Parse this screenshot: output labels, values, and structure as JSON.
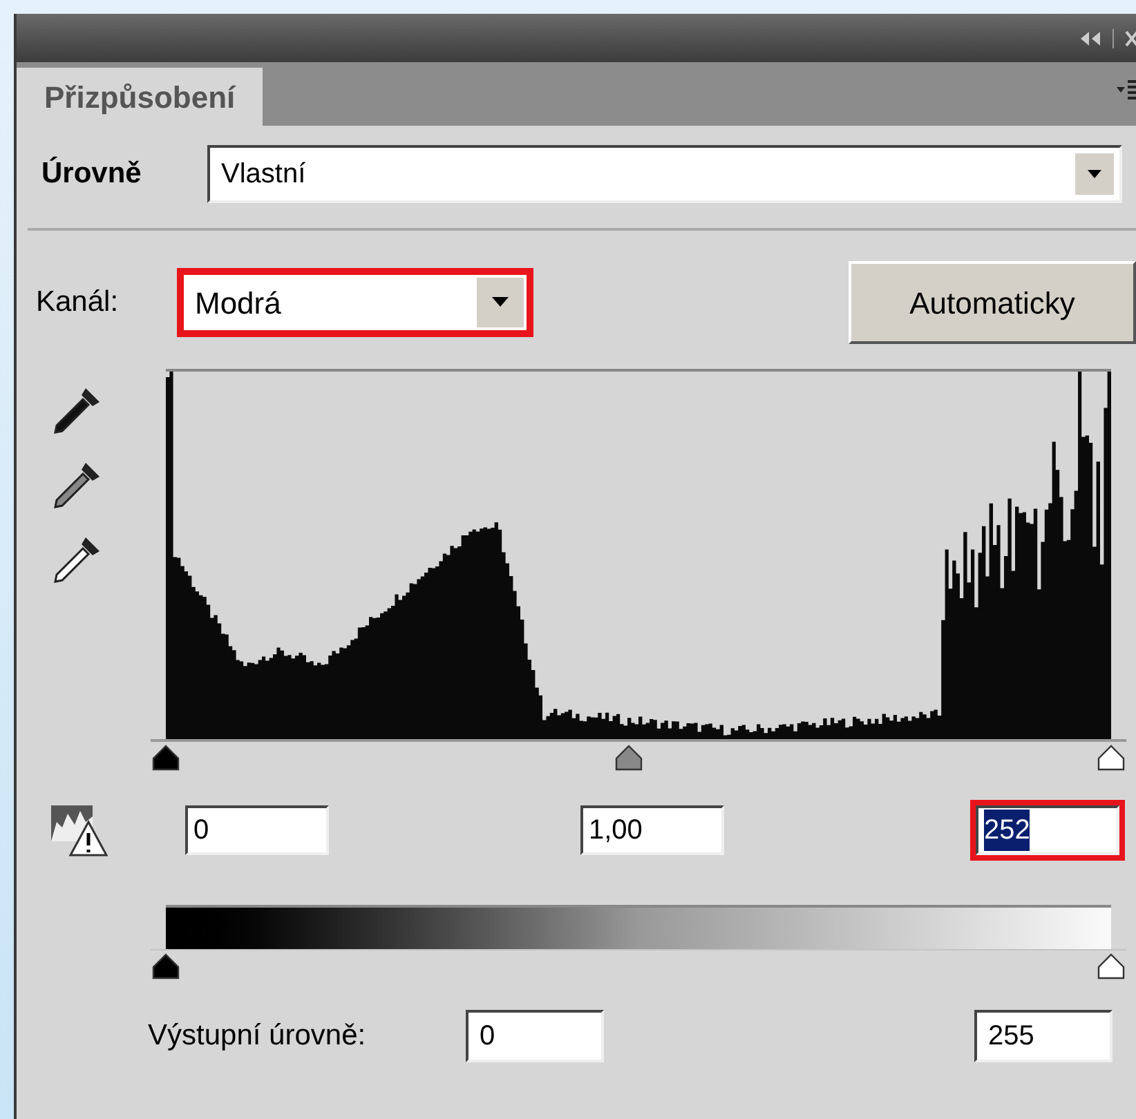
{
  "tab": {
    "label": "Přizpůsobení",
    "selected": true
  },
  "preset": {
    "label": "Úrovně",
    "value": "Vlastní"
  },
  "channel": {
    "label": "Kanál:",
    "value": "Modrá",
    "highlighted": true
  },
  "auto_button": "Automaticky",
  "input_sliders": [
    {
      "kind": "black",
      "level": 0
    },
    {
      "kind": "gray",
      "level": 0.49
    },
    {
      "kind": "white",
      "level": 1
    }
  ],
  "input_fields": [
    {
      "value": "0",
      "highlighted": false,
      "text_selected": false
    },
    {
      "value": "1,00",
      "highlighted": false,
      "text_selected": false
    },
    {
      "value": "252",
      "highlighted": true,
      "text_selected": true
    }
  ],
  "output_label": "Výstupní úrovně:",
  "output_sliders": [
    {
      "kind": "black",
      "level": 0
    },
    {
      "kind": "white",
      "level": 1
    }
  ],
  "output_fields": [
    {
      "value": "0"
    },
    {
      "value": "255"
    }
  ]
}
